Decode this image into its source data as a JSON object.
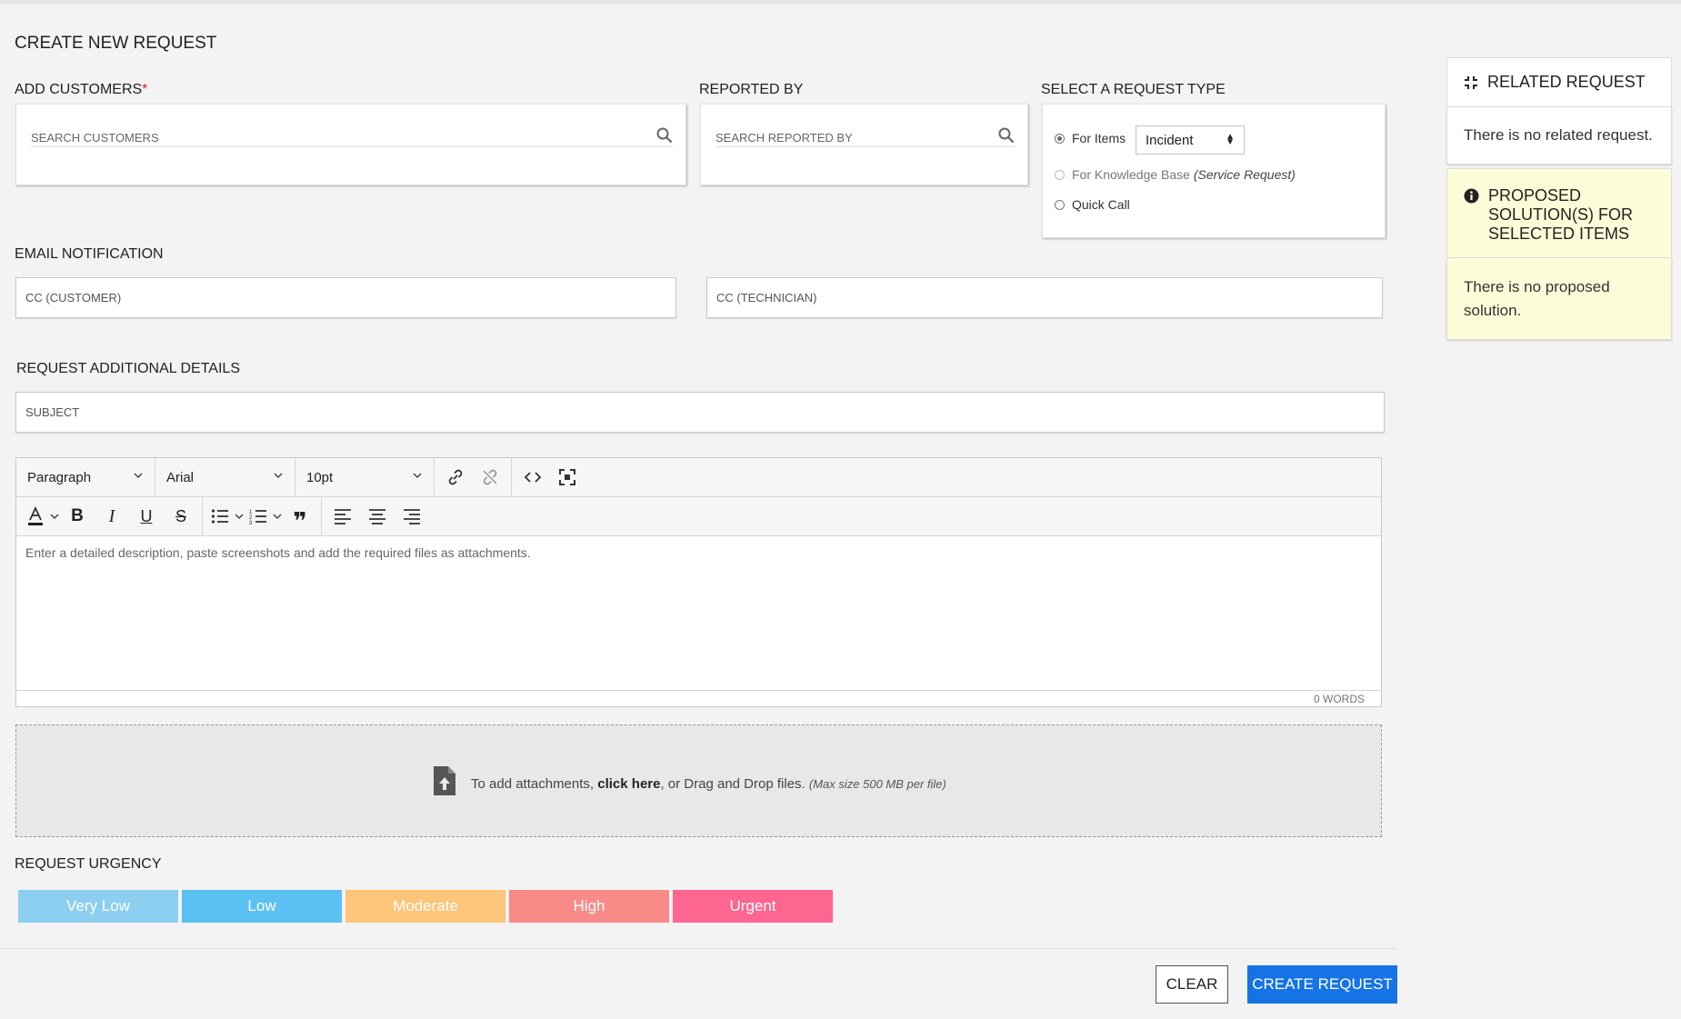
{
  "page": {
    "title": "CREATE NEW REQUEST"
  },
  "customers": {
    "label": "ADD CUSTOMERS",
    "required_mark": "*",
    "placeholder": "SEARCH CUSTOMERS"
  },
  "reported_by": {
    "label": "REPORTED BY",
    "placeholder": "SEARCH REPORTED BY"
  },
  "request_type": {
    "label": "SELECT A REQUEST TYPE",
    "options": [
      {
        "label": "For Items",
        "checked": true
      },
      {
        "label": "For Knowledge Base",
        "suffix": "(Service Request)",
        "disabled": true
      },
      {
        "label": "Quick Call",
        "checked": false
      }
    ],
    "select_value": "Incident"
  },
  "email_notification": {
    "label": "EMAIL NOTIFICATION",
    "cc_customer_placeholder": "CC (CUSTOMER)",
    "cc_technician_placeholder": "CC (TECHNICIAN)"
  },
  "additional_details": {
    "label": "REQUEST ADDITIONAL DETAILS",
    "subject_placeholder": "SUBJECT"
  },
  "editor": {
    "paragraph": "Paragraph",
    "font": "Arial",
    "size": "10pt",
    "placeholder": "Enter a detailed description, paste screenshots and add the required files as attachments.",
    "word_count": "0 WORDS"
  },
  "attachments": {
    "text_before": "To add attachments, ",
    "link": "click here",
    "text_after": ", or Drag and Drop files. ",
    "note": "(Max size 500 MB per file)"
  },
  "urgency": {
    "label": "REQUEST URGENCY",
    "levels": [
      {
        "label": "Very Low",
        "color": "#8dcff0"
      },
      {
        "label": "Low",
        "color": "#5bc0f2"
      },
      {
        "label": "Moderate",
        "color": "#fdc57a"
      },
      {
        "label": "High",
        "color": "#f88b87"
      },
      {
        "label": "Urgent",
        "color": "#fc6691"
      }
    ]
  },
  "actions": {
    "clear": "CLEAR",
    "create": "CREATE REQUEST"
  },
  "related": {
    "title": "RELATED REQUEST",
    "body": "There is no related request."
  },
  "proposed": {
    "title": "PROPOSED SOLUTION(S) FOR SELECTED ITEMS",
    "body": "There is no proposed solution."
  },
  "colors": {
    "accent": "#1673e6",
    "required": "#e02020",
    "proposed_bg": "#fdfcd8"
  },
  "icons": [
    "search-icon",
    "link-icon",
    "unlink-icon",
    "code-icon",
    "fullscreen-icon",
    "font-color-icon",
    "bold-icon",
    "italic-icon",
    "underline-icon",
    "strikethrough-icon",
    "bullet-list-icon",
    "numbered-list-icon",
    "quote-icon",
    "align-left-icon",
    "align-center-icon",
    "align-right-icon",
    "upload-file-icon",
    "collapse-icon",
    "info-icon"
  ]
}
